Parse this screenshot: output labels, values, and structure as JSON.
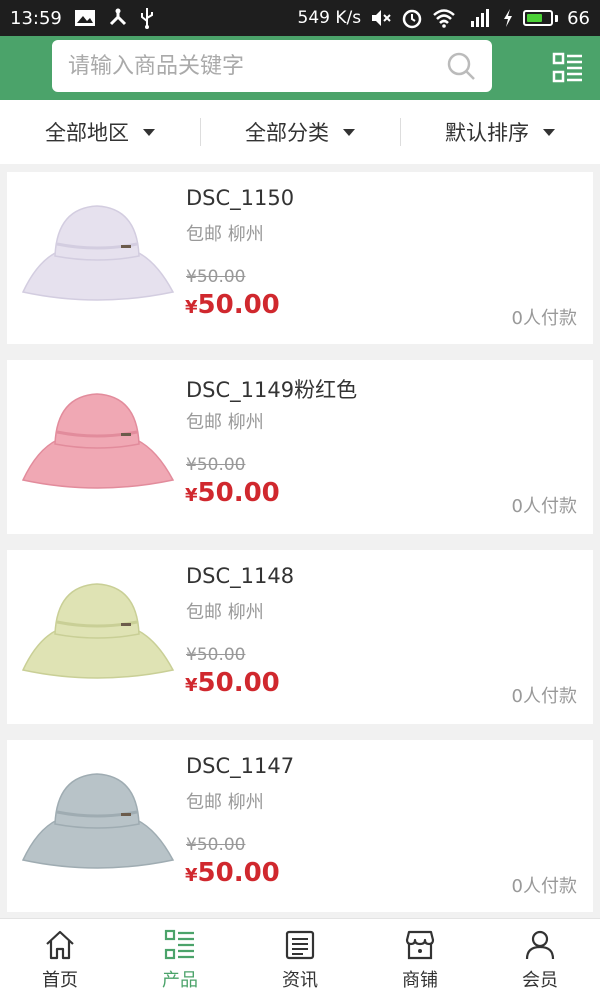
{
  "status_bar": {
    "time": "13:59",
    "speed": "549 K/s",
    "battery": "66"
  },
  "search": {
    "placeholder": "请输入商品关键字"
  },
  "filters": [
    {
      "label": "全部地区"
    },
    {
      "label": "全部分类"
    },
    {
      "label": "默认排序"
    }
  ],
  "products": [
    {
      "title": "DSC_1150",
      "tags": "包邮 柳州",
      "old_price": "¥50.00",
      "currency": "¥",
      "price": "50.00",
      "sold": "0人付款",
      "hat_color": "#e6e1ee",
      "band_color": "#d3cde0"
    },
    {
      "title": "DSC_1149粉红色",
      "tags": "包邮 柳州",
      "old_price": "¥50.00",
      "currency": "¥",
      "price": "50.00",
      "sold": "0人付款",
      "hat_color": "#f0a8b4",
      "band_color": "#e28c9c"
    },
    {
      "title": "DSC_1148",
      "tags": "包邮 柳州",
      "old_price": "¥50.00",
      "currency": "¥",
      "price": "50.00",
      "sold": "0人付款",
      "hat_color": "#dfe3b4",
      "band_color": "#c9cf96"
    },
    {
      "title": "DSC_1147",
      "tags": "包邮 柳州",
      "old_price": "¥50.00",
      "currency": "¥",
      "price": "50.00",
      "sold": "0人付款",
      "hat_color": "#b8c3c8",
      "band_color": "#9facb2"
    }
  ],
  "nav": [
    {
      "label": "首页",
      "icon": "home-icon"
    },
    {
      "label": "产品",
      "icon": "list-icon",
      "active": true
    },
    {
      "label": "资讯",
      "icon": "news-icon"
    },
    {
      "label": "商铺",
      "icon": "store-icon"
    },
    {
      "label": "会员",
      "icon": "user-icon"
    }
  ],
  "colors": {
    "brand": "#4ba36a",
    "price": "#d0282e"
  }
}
